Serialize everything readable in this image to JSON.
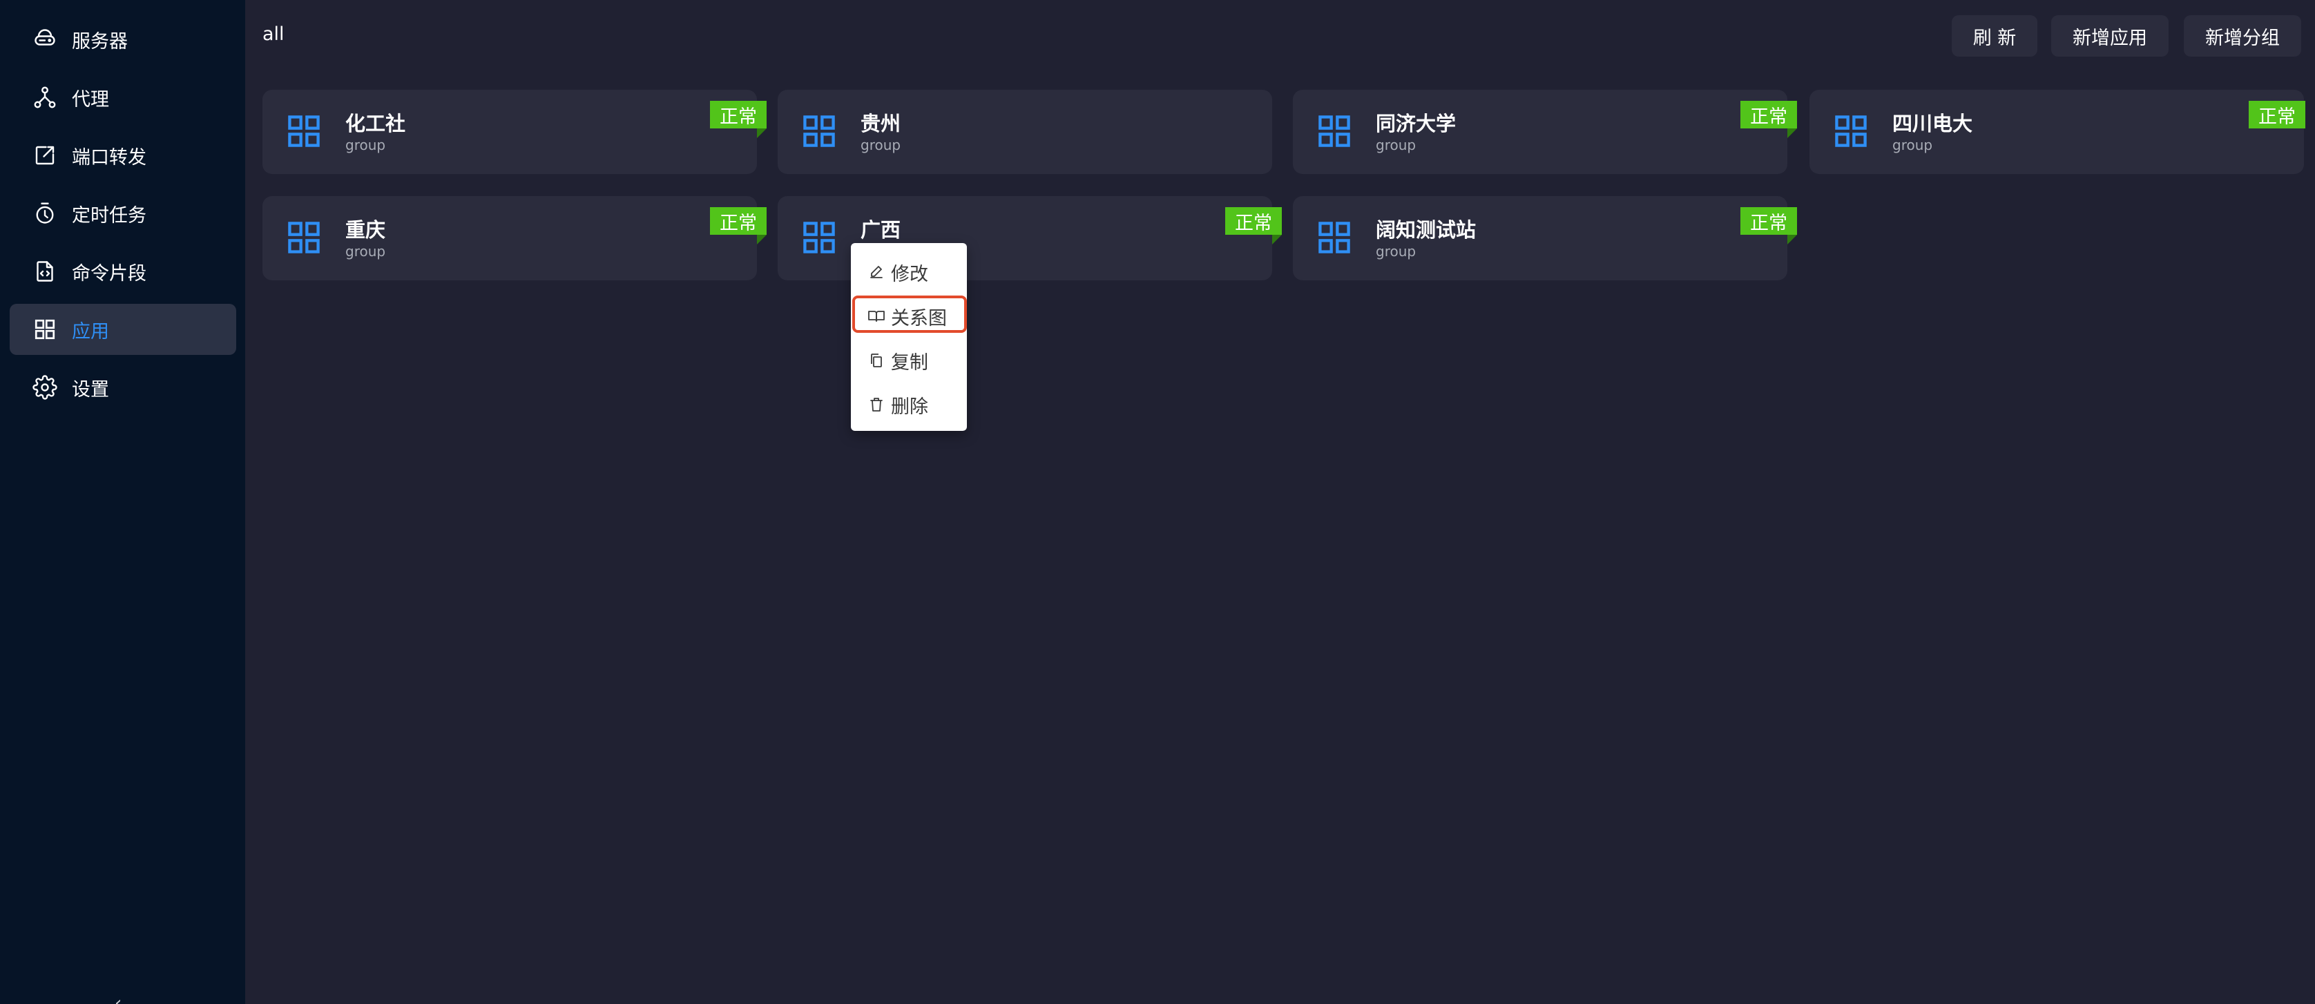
{
  "sidebar": {
    "items": [
      {
        "label": "服务器",
        "icon": "server-icon"
      },
      {
        "label": "代理",
        "icon": "proxy-icon"
      },
      {
        "label": "端口转发",
        "icon": "port-forward-icon"
      },
      {
        "label": "定时任务",
        "icon": "timer-icon"
      },
      {
        "label": "命令片段",
        "icon": "code-file-icon"
      },
      {
        "label": "应用",
        "icon": "apps-grid-icon",
        "active": true
      },
      {
        "label": "设置",
        "icon": "gear-icon"
      }
    ],
    "collapse_glyph": "‹"
  },
  "header": {
    "filter": "all",
    "refresh_label": "刷 新",
    "add_app_label": "新增应用",
    "add_group_label": "新增分组"
  },
  "cards": [
    {
      "name": "化工社",
      "type": "group",
      "status": "正常"
    },
    {
      "name": "贵州",
      "type": "group",
      "status": ""
    },
    {
      "name": "同济大学",
      "type": "group",
      "status": "正常"
    },
    {
      "name": "四川电大",
      "type": "group",
      "status": "正常"
    },
    {
      "name": "重庆",
      "type": "group",
      "status": "正常"
    },
    {
      "name": "广西",
      "type": "group",
      "status": "正常"
    },
    {
      "name": "阔知测试站",
      "type": "group",
      "status": "正常"
    }
  ],
  "context_menu": {
    "items": [
      {
        "label": "修改",
        "icon": "edit-icon"
      },
      {
        "label": "关系图",
        "icon": "book-icon",
        "highlighted": true
      },
      {
        "label": "复制",
        "icon": "copy-icon"
      },
      {
        "label": "删除",
        "icon": "trash-icon"
      }
    ]
  },
  "colors": {
    "sidebar_bg": "#061427",
    "content_bg": "#202132",
    "card_bg": "#2b2c3d",
    "accent_blue": "#2f8ff5",
    "status_green": "#52c41a",
    "highlight_red": "#e24b2c"
  }
}
